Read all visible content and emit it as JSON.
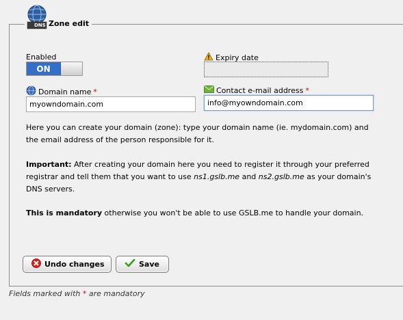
{
  "zone": {
    "title": "Zone edit",
    "logo_badge": "DNS",
    "enabled_label": "Enabled",
    "toggle_on_label": "ON",
    "expiry_label": "Expiry date",
    "expiry_value": "",
    "domain_label": "Domain name",
    "domain_value": "myowndomain.com",
    "email_label": "Contact e-mail address",
    "email_value": "info@myowndomain.com",
    "required_marker": "*"
  },
  "help": {
    "intro": "Here you can create your domain (zone): type your domain name (ie. mydomain.com) and the email address of the person responsible for it.",
    "important_label": "Important:",
    "important_text_1": " After creating your domain here you need to register it through your preferred registrar and tell them that you want to use ",
    "ns1": "ns1.gslb.me",
    "and_text": " and ",
    "ns2": "ns2.gslb.me",
    "important_text_2": " as your domain's DNS servers.",
    "mandatory_label": "This is mandatory",
    "mandatory_text": " otherwise you won't be able to use GSLB.me to handle your domain."
  },
  "actions": {
    "undo_label": "Undo changes",
    "save_label": "Save"
  },
  "footer": {
    "note_before": "Fields marked with ",
    "note_marker": "*",
    "note_after": " are mandatory"
  },
  "icons": {
    "legend": "dns-globe-icon",
    "expiry": "warning-icon",
    "domain": "globe-icon",
    "email": "envelope-icon",
    "undo": "red-x-icon",
    "save": "green-check-icon"
  },
  "colors": {
    "toggle_on": "#3470c8",
    "required": "#d40000",
    "focus_border": "#7aa1d6"
  }
}
